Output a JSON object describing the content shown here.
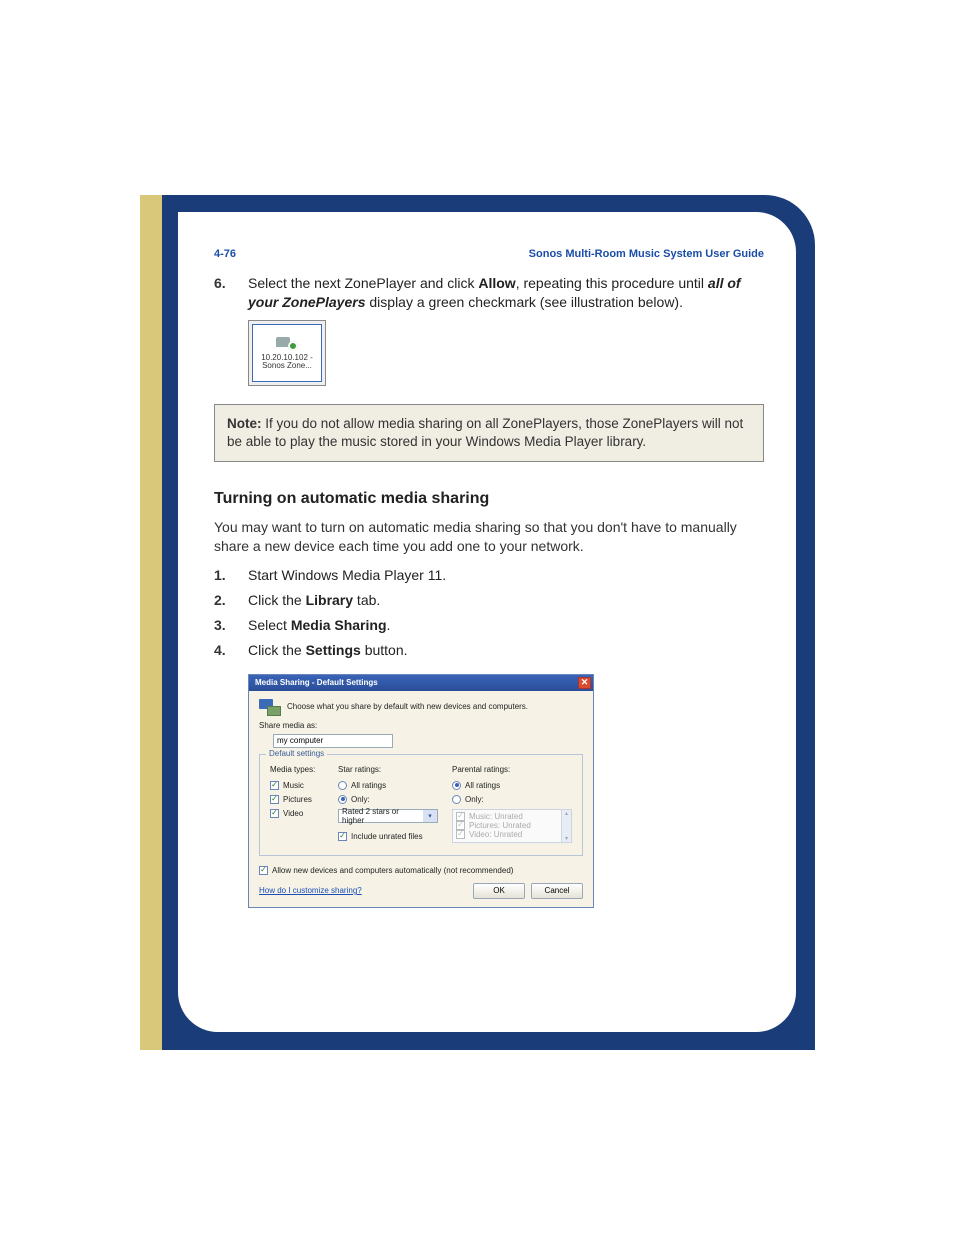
{
  "header": {
    "page_ref": "4-76",
    "guide_title": "Sonos Multi-Room Music System User Guide"
  },
  "step6": {
    "num": "6.",
    "pre": "Select the next ZonePlayer and click ",
    "allow": "Allow",
    "mid": ", repeating this procedure until ",
    "all_of": "all of your ZonePlayers",
    "post": " display a green checkmark (see illustration below)."
  },
  "zone_icon": {
    "line1": "10.20.10.102 -",
    "line2": "Sonos Zone..."
  },
  "note": {
    "label": "Note:",
    "text": " If you do not allow media sharing on all ZonePlayers, those ZonePlayers will not be able to play the music stored in your Windows Media Player library."
  },
  "section_title": "Turning on automatic media sharing",
  "section_intro": "You may want to turn on automatic media sharing so that you don't have to manually share a new device each time you add one to your network.",
  "steps": {
    "n1": "1.",
    "t1": "Start Windows Media Player 11.",
    "n2": "2.",
    "t2a": "Click the ",
    "t2b": "Library",
    "t2c": " tab.",
    "n3": "3.",
    "t3a": "Select ",
    "t3b": "Media Sharing",
    "t3c": ".",
    "n4": "4.",
    "t4a": "Click the ",
    "t4b": "Settings",
    "t4c": " button."
  },
  "dialog": {
    "title": "Media Sharing - Default Settings",
    "desc": "Choose what you share by default with new devices and computers.",
    "share_as_label": "Share media as:",
    "share_as_value": "my computer",
    "fieldset_legend": "Default settings",
    "col_media_types": "Media types:",
    "chk_music": "Music",
    "chk_pictures": "Pictures",
    "chk_video": "Video",
    "col_star": "Star ratings:",
    "rad_all": "All ratings",
    "rad_only": "Only:",
    "dd_value": "Rated 2 stars or higher",
    "chk_include": "Include unrated files",
    "col_parental": "Parental ratings:",
    "list_music": "Music: Unrated",
    "list_pictures": "Pictures: Unrated",
    "list_video": "Video: Unrated",
    "autoshare": "Allow new devices and computers automatically (not recommended)",
    "help_link": "How do I customize sharing?",
    "ok": "OK",
    "cancel": "Cancel"
  }
}
